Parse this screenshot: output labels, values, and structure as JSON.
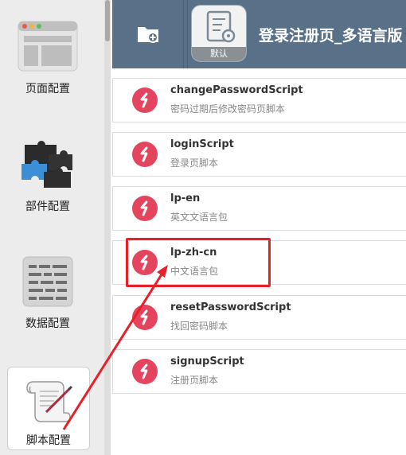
{
  "sidebar": {
    "items": [
      {
        "label": "页面配置",
        "icon": "page-layout-icon"
      },
      {
        "label": "部件配置",
        "icon": "puzzle-pieces-icon"
      },
      {
        "label": "数据配置",
        "icon": "data-grid-icon"
      },
      {
        "label": "脚本配置",
        "icon": "script-scroll-icon"
      }
    ],
    "active": "脚本配置"
  },
  "header": {
    "title": "登录注册页_多语言版",
    "app_badge": "默认",
    "add_icon": "folder-add-icon"
  },
  "scripts": [
    {
      "name": "changePasswordScript",
      "desc": "密码过期后修改密码页脚本"
    },
    {
      "name": "loginScript",
      "desc": "登录页脚本"
    },
    {
      "name": "lp-en",
      "desc": "英文文语言包"
    },
    {
      "name": "lp-zh-cn",
      "desc": "中文语言包"
    },
    {
      "name": "resetPasswordScript",
      "desc": "找回密码脚本"
    },
    {
      "name": "signupScript",
      "desc": "注册页脚本"
    }
  ],
  "colors": {
    "header_bg": "#587189",
    "script_icon": "#e5445f",
    "highlight": "#e8202a"
  }
}
